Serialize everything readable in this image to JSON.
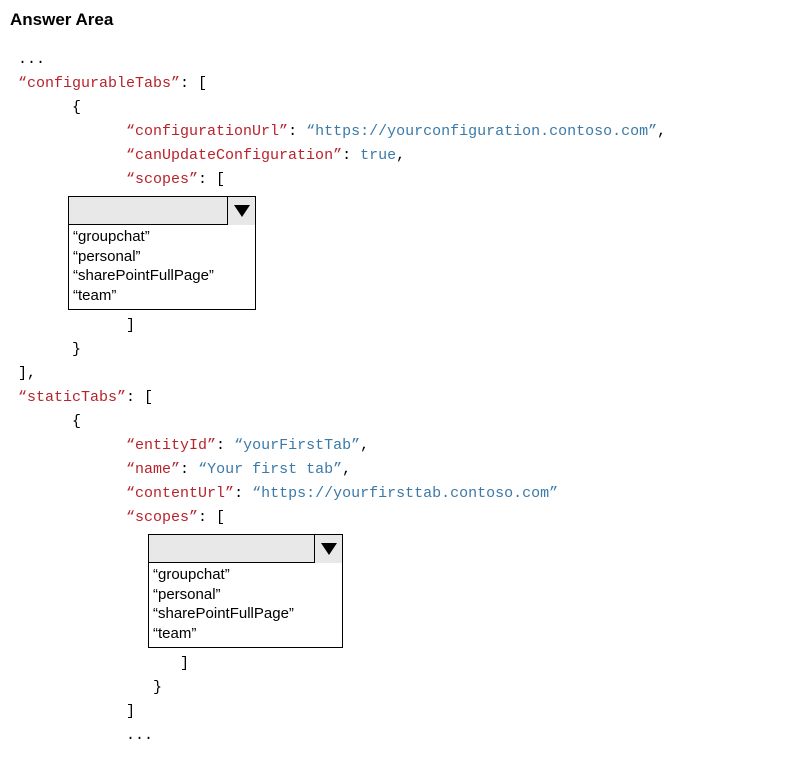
{
  "title": "Answer Area",
  "code": {
    "ellipsis": "...",
    "configurableTabs_key": "“configurableTabs”",
    "configurationUrl_key": "“configurationUrl”",
    "configurationUrl_val": "“https://yourconfiguration.contoso.com”",
    "canUpdateConfiguration_key": "“canUpdateConfiguration”",
    "canUpdateConfiguration_val": "true",
    "scopes_key": "“scopes”",
    "staticTabs_key": "“staticTabs”",
    "entityId_key": "“entityId”",
    "entityId_val": "“yourFirstTab”",
    "name_key": "“name”",
    "name_val": "“Your first tab”",
    "contentUrl_key": "“contentUrl”",
    "contentUrl_val": "“https://yourfirsttab.contoso.com”"
  },
  "dropdown1": {
    "options": {
      "opt1": "“groupchat”",
      "opt2": "“personal”",
      "opt3": "“sharePointFullPage”",
      "opt4": "“team”"
    }
  },
  "dropdown2": {
    "options": {
      "opt1": "“groupchat”",
      "opt2": "“personal”",
      "opt3": "“sharePointFullPage”",
      "opt4": "“team”"
    }
  }
}
